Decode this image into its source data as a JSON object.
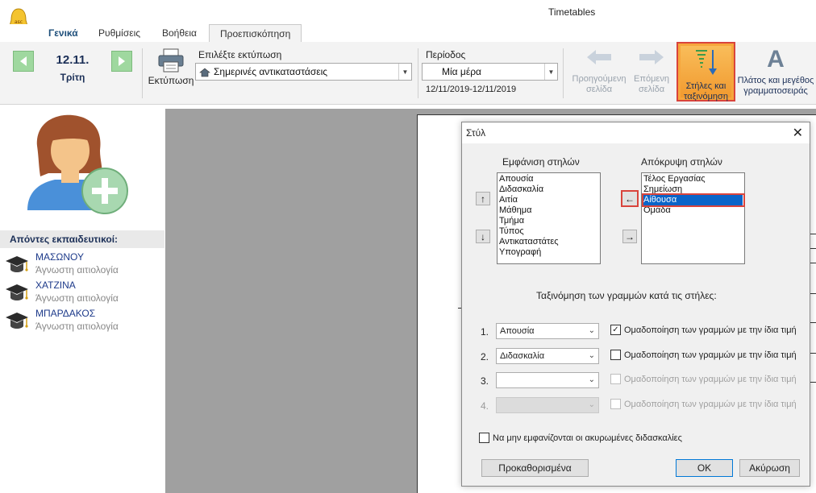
{
  "window": {
    "title": "Timetables"
  },
  "tabs": [
    {
      "label": "Γενικά"
    },
    {
      "label": "Ρυθμίσεις"
    },
    {
      "label": "Βοήθεια"
    },
    {
      "label": "Προεπισκόπηση"
    }
  ],
  "ribbon": {
    "date": "12.11.",
    "day": "Τρίτη",
    "print_label": "Εκτύπωση",
    "choose_print_label": "Επιλέξτε εκτύπωση",
    "print_selection": "Σημερινές αντικαταστάσεις",
    "period_label": "Περίοδος",
    "period_selection": "Μία μέρα",
    "period_range": "12/11/2019-12/11/2019",
    "prev_page": [
      "Προηγούμενη",
      "σελίδα"
    ],
    "next_page": [
      "Επόμενη",
      "σελίδα"
    ],
    "columns_sort": [
      "Στήλες και",
      "ταξινόμηση"
    ],
    "font_size": [
      "Πλάτος και μεγέθος",
      "γραμματοσειράς"
    ],
    "font_icon_letter": "A"
  },
  "left_panel": {
    "absent_header": "Απόντες εκπαιδευτικοί:",
    "teachers": [
      {
        "name": "ΜΑΣΩΝΟΥ",
        "reason": "Άγνωστη αιτιολογία"
      },
      {
        "name": "ΧΑΤΖΙΝΑ",
        "reason": "Άγνωστη αιτιολογία"
      },
      {
        "name": "ΜΠΑΡΔΑΚΟΣ",
        "reason": "Άγνωστη αιτιολογία"
      }
    ]
  },
  "dialog": {
    "title": "Στύλ",
    "close_glyph": "✕",
    "shown_label": "Εμφάνιση στηλών",
    "hidden_label": "Απόκρυψη στηλών",
    "shown_columns": [
      "Απουσία",
      "Διδασκαλία",
      "Αιτία",
      "Μάθημα",
      "Τμήμα",
      "Τύπος",
      "Αντικαταστάτες",
      "Υπογραφή"
    ],
    "hidden_columns": [
      "Τέλος Εργασίας",
      "Σημείωση",
      "Αίθουσα",
      "Ομάδα"
    ],
    "hidden_selected_index": 2,
    "up_glyph": "↑",
    "down_glyph": "↓",
    "left_glyph": "←",
    "right_glyph": "→",
    "sort_label": "Ταξινόμηση των γραμμών κατά τις στήλες:",
    "sort_rows": [
      {
        "num": "1.",
        "value": "Απουσία",
        "group_label": "Ομαδοποίηση των γραμμών με την ίδια τιμή",
        "checked": true,
        "enabled": true
      },
      {
        "num": "2.",
        "value": "Διδασκαλία",
        "group_label": "Ομαδοποίηση των γραμμών με την ίδια τιμή",
        "checked": false,
        "enabled": true
      },
      {
        "num": "3.",
        "value": "",
        "group_label": "Ομαδοποίηση των γραμμών με την ίδια τιμή",
        "checked": false,
        "enabled": false
      },
      {
        "num": "4.",
        "value": "",
        "group_label": "Ομαδοποίηση των γραμμών με την ίδια τιμή",
        "checked": false,
        "enabled": false
      }
    ],
    "hide_cancelled_label": "Να μην εμφανίζονται οι ακυρωμένες διδασκαλίες",
    "defaults_button": "Προκαθορισμένα",
    "ok_button": "OK",
    "cancel_button": "Ακύρωση"
  }
}
